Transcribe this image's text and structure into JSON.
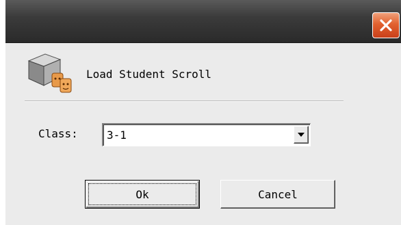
{
  "dialog": {
    "heading": "Load Student Scroll",
    "class_label": "Class:",
    "class_value": "3-1",
    "ok_label": "Ok",
    "cancel_label": "Cancel"
  },
  "icons": {
    "close": "close-icon",
    "app": "student-scroll-icon",
    "dropdown": "chevron-down-icon"
  },
  "colors": {
    "titlebar": "#3b3b3b",
    "close_button": "#e2612f",
    "dialog_background": "#ebebeb"
  }
}
